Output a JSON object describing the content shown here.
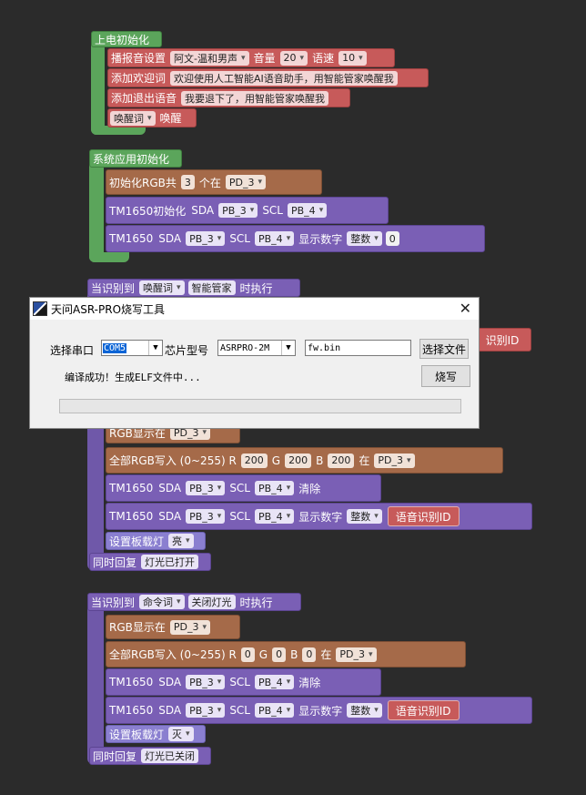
{
  "b1": {
    "hat": "上电初始化",
    "play": {
      "label": "播报音设置",
      "voice": "阿文-温和男声",
      "vol_label": "音量",
      "vol": "20",
      "speed_label": "语速",
      "speed": "10"
    },
    "welcome": {
      "label": "添加欢迎词",
      "text": "欢迎使用人工智能AI语音助手，用智能管家唤醒我"
    },
    "exit": {
      "label": "添加退出语音",
      "text": "我要退下了，用智能管家唤醒我"
    },
    "wake": {
      "type": "唤醒词",
      "text": "唤醒"
    }
  },
  "b2": {
    "hat": "系统应用初始化",
    "rgb": {
      "label": "初始化RGB共",
      "count": "3",
      "mid": "个在",
      "pin": "PD_3"
    },
    "tm1": {
      "label": "TM1650初始化",
      "sda": "SDA",
      "sda_pin": "PB_3",
      "scl": "SCL",
      "scl_pin": "PB_4"
    },
    "tm2": {
      "label": "TM1650",
      "sda": "SDA",
      "sda_pin": "PB_3",
      "scl": "SCL",
      "scl_pin": "PB_4",
      "show": "显示数字",
      "fmt": "整数",
      "val": "0"
    }
  },
  "b3": {
    "hat_label": "当识别到",
    "kind": "唤醒词",
    "word": "智能管家",
    "tail": "时执行",
    "right_slot": "识别ID",
    "rgb": {
      "label": "RGB显示在",
      "pin": "PD_3"
    },
    "all": {
      "label": "全部RGB写入 (0~255) R",
      "r": "200",
      "g_label": "G",
      "g": "200",
      "b_label": "B",
      "b": "200",
      "at": "在",
      "pin": "PD_3"
    },
    "tm_clear": {
      "label": "TM1650",
      "sda": "SDA",
      "sda_pin": "PB_3",
      "scl": "SCL",
      "scl_pin": "PB_4",
      "act": "清除"
    },
    "tm_show": {
      "label": "TM1650",
      "sda": "SDA",
      "sda_pin": "PB_3",
      "scl": "SCL",
      "scl_pin": "PB_4",
      "show": "显示数字",
      "fmt": "整数",
      "slot": "语音识别ID"
    },
    "led": {
      "label": "设置板载灯",
      "state": "亮"
    },
    "reply": {
      "label": "同时回复",
      "text": "灯光已打开"
    }
  },
  "b4": {
    "hat_label": "当识别到",
    "kind": "命令词",
    "word": "关闭灯光",
    "tail": "时执行",
    "rgb": {
      "label": "RGB显示在",
      "pin": "PD_3"
    },
    "all": {
      "label": "全部RGB写入 (0~255) R",
      "r": "0",
      "g_label": "G",
      "g": "0",
      "b_label": "B",
      "b": "0",
      "at": "在",
      "pin": "PD_3"
    },
    "tm_clear": {
      "label": "TM1650",
      "sda": "SDA",
      "sda_pin": "PB_3",
      "scl": "SCL",
      "scl_pin": "PB_4",
      "act": "清除"
    },
    "tm_show": {
      "label": "TM1650",
      "sda": "SDA",
      "sda_pin": "PB_3",
      "scl": "SCL",
      "scl_pin": "PB_4",
      "show": "显示数字",
      "fmt": "整数",
      "slot": "语音识别ID"
    },
    "led": {
      "label": "设置板载灯",
      "state": "灭"
    },
    "reply": {
      "label": "同时回复",
      "text": "灯光已关闭"
    }
  },
  "dialog": {
    "title": "天问ASR-PRO烧写工具",
    "close": "✕",
    "port_label": "选择串口",
    "port": "COM5",
    "chip_label": "芯片型号",
    "chip": "ASRPRO-2M",
    "file": "fw.bin",
    "select_btn": "选择文件",
    "burn_btn": "烧写",
    "status": "编译成功！生成ELF文件中...",
    "progress": 0
  },
  "colors": {
    "bg": "#2b2b2b",
    "green": "#5ba55b",
    "red": "#c75a5a",
    "brown": "#a56a49",
    "purple": "#7a5fb5"
  }
}
